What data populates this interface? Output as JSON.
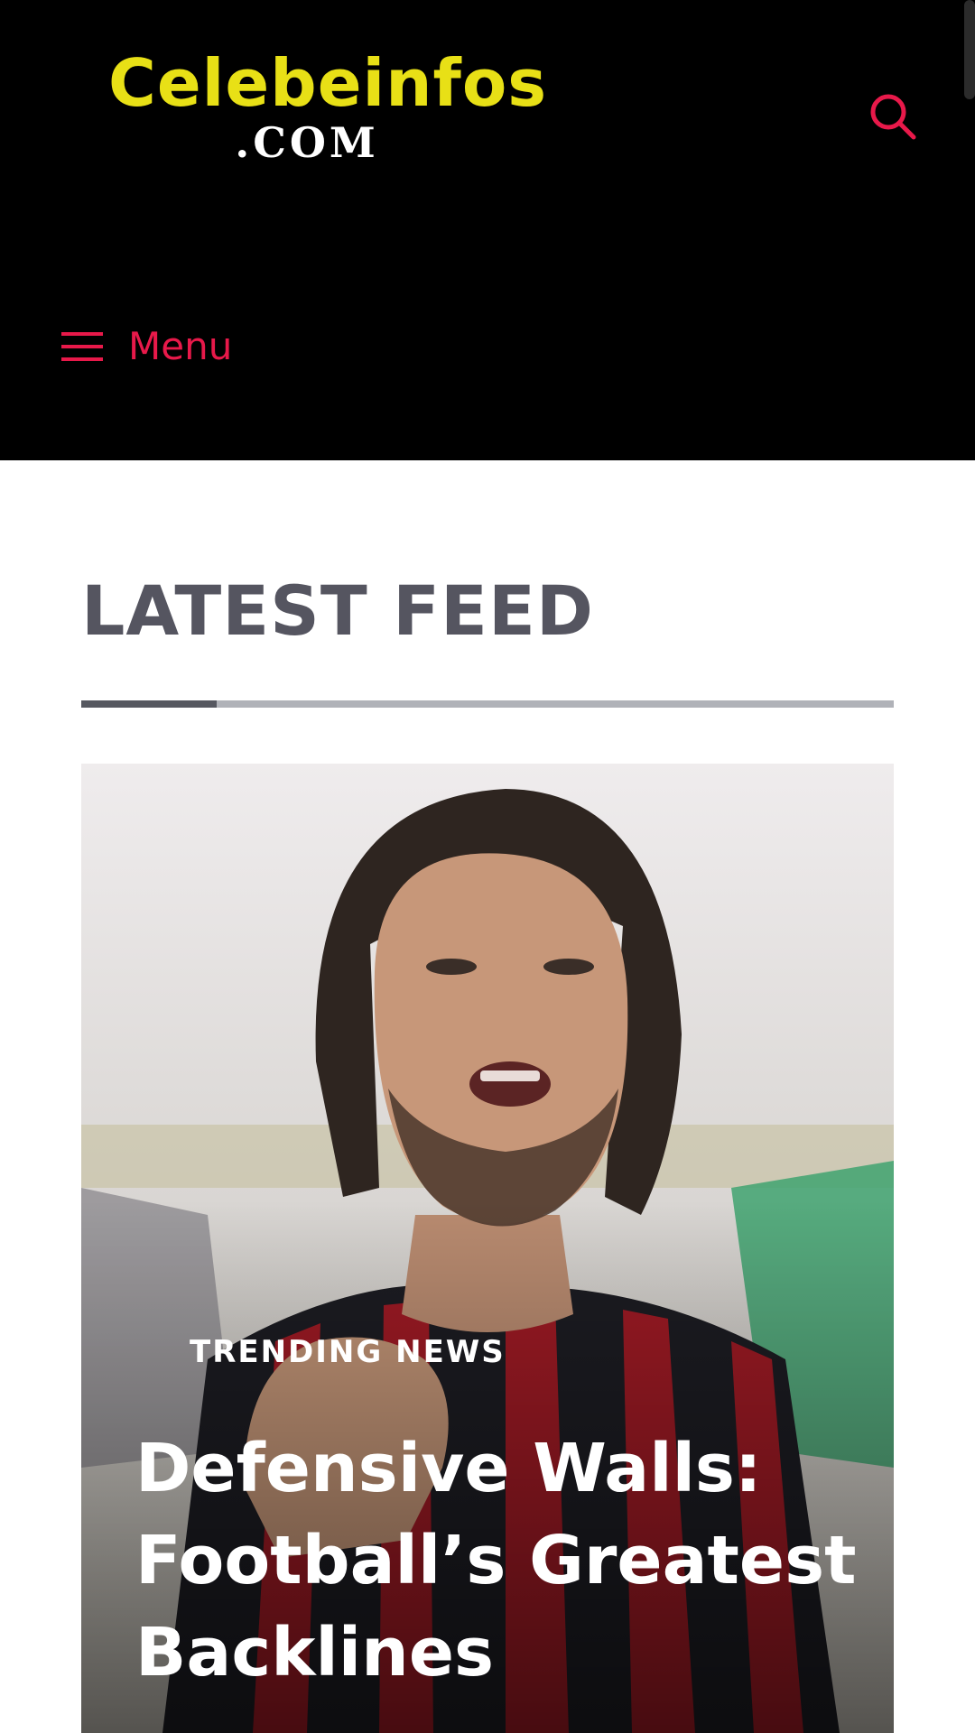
{
  "header": {
    "logo_main": "Celebeinfos",
    "logo_sub": ".COM",
    "search_icon": "search-icon",
    "menu_icon": "hamburger-icon",
    "menu_label": "Menu",
    "colors": {
      "background": "#000000",
      "logo": "#e8e016",
      "accent": "#e8194a"
    }
  },
  "main": {
    "section_title": "LATEST FEED",
    "featured": {
      "category": "TRENDING NEWS",
      "title": "Defensive Walls: Football’s Greatest Backlines"
    }
  }
}
